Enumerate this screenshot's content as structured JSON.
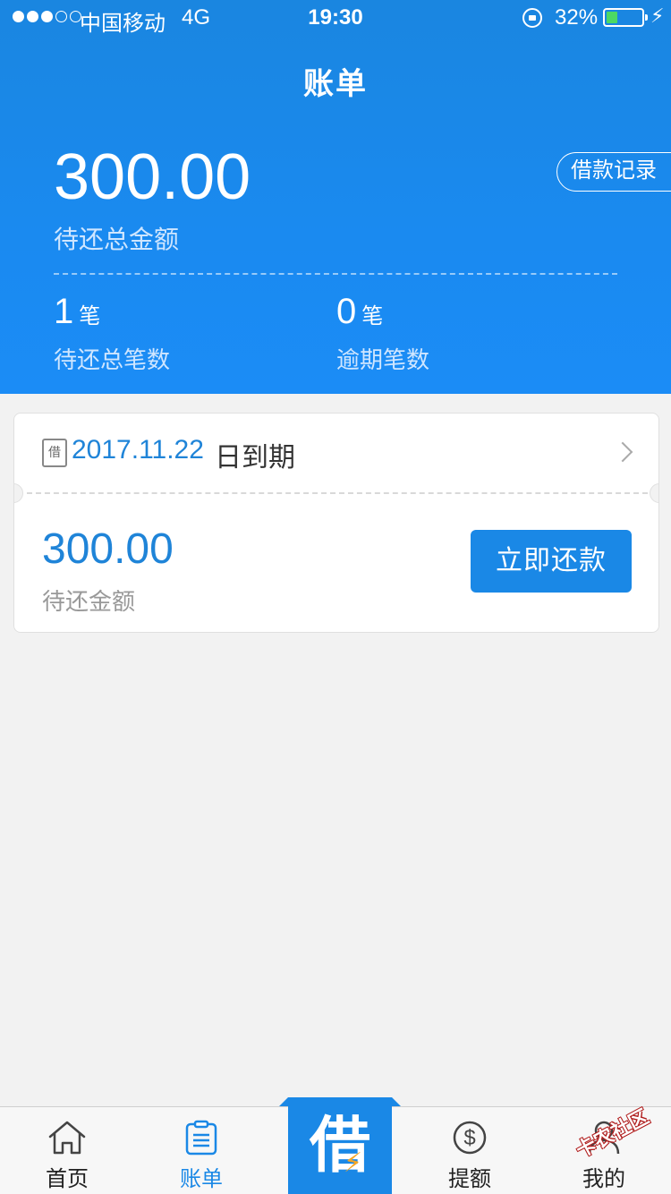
{
  "status_bar": {
    "carrier": "中国移动",
    "network": "4G",
    "time": "19:30",
    "battery_percent": "32%",
    "battery_level": 0.32,
    "icons": [
      "signal-dots-icon",
      "orientation-lock-icon",
      "battery-icon",
      "charging-bolt-icon"
    ]
  },
  "header": {
    "title": "账单",
    "total_amount": "300.00",
    "total_amount_label": "待还总金额",
    "loan_record_button": "借款记录",
    "pending_count": "1",
    "pending_unit": "笔",
    "pending_label": "待还总笔数",
    "overdue_count": "0",
    "overdue_unit": "笔",
    "overdue_label": "逾期笔数"
  },
  "bill": {
    "icon_char": "借",
    "due_date": "2017.11.22",
    "due_suffix": "日到期",
    "amount": "300.00",
    "amount_label": "待还金额",
    "repay_button": "立即还款"
  },
  "tabs": [
    {
      "label": "首页",
      "icon": "home-icon",
      "active": false
    },
    {
      "label": "账单",
      "icon": "bill-icon",
      "active": true
    },
    {
      "label": "借",
      "icon": "borrow-icon",
      "active": false
    },
    {
      "label": "提额",
      "icon": "dollar-icon",
      "active": false
    },
    {
      "label": "我的",
      "icon": "user-icon",
      "active": false
    }
  ],
  "watermark": "卡农社区",
  "colors": {
    "primary": "#1a88e6",
    "header_gradient_top": "#1a86e0",
    "header_gradient_bottom": "#1b8cf6",
    "background": "#f2f2f2",
    "battery_fill": "#4cd964"
  }
}
